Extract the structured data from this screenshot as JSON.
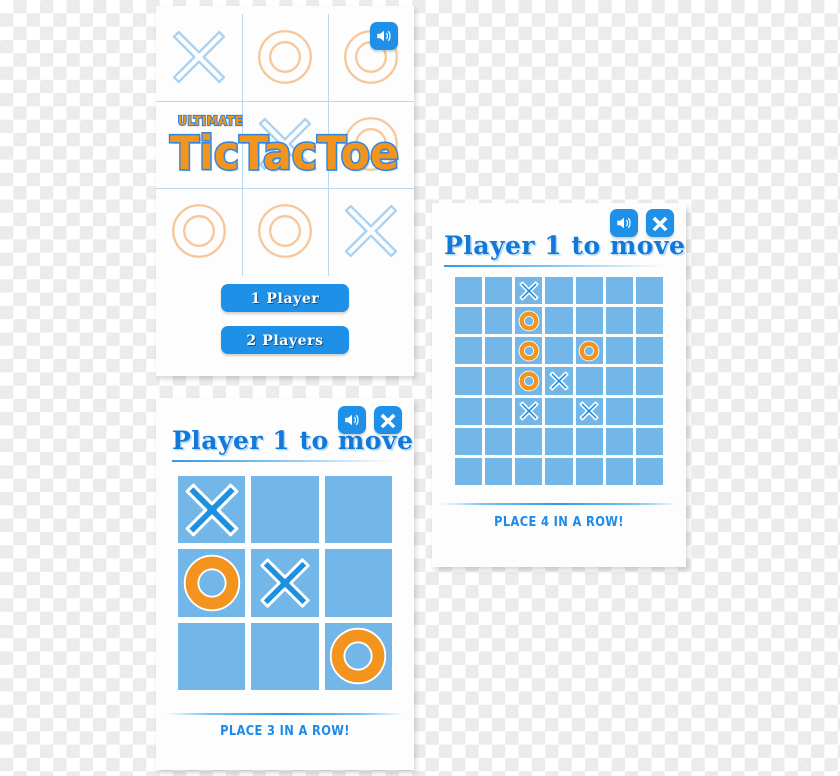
{
  "colors": {
    "brand_blue": "#1E90E8",
    "title_blue": "#1478D8",
    "cell_blue": "#72B7E8",
    "x_blue": "#1E90E0",
    "o_orange": "#F2941E",
    "grid_line": "#b9d9f2",
    "panel_bg": "#fdfdfd"
  },
  "splash": {
    "sound_icon": "speaker-icon",
    "logo_kicker": "ULTIMATE",
    "logo_title": "TicTacToe",
    "background_marks": [
      [
        "X",
        "O",
        "O"
      ],
      [
        "",
        "X",
        "O"
      ],
      [
        "O",
        "O",
        "X"
      ]
    ],
    "buttons": [
      {
        "label": "1 Player"
      },
      {
        "label": "2 Players"
      }
    ]
  },
  "game3": {
    "sound_icon": "speaker-icon",
    "close_icon": "close-x-icon",
    "title": "Player 1 to move",
    "footer": "PLACE 3 IN A ROW!",
    "board": {
      "rows": 3,
      "cols": 3,
      "cells": [
        [
          "X",
          "",
          ""
        ],
        [
          "O",
          "X",
          ""
        ],
        [
          "",
          "",
          "O"
        ]
      ]
    }
  },
  "game7": {
    "sound_icon": "speaker-icon",
    "close_icon": "close-x-icon",
    "title": "Player 1 to move",
    "footer": "PLACE 4 IN A ROW!",
    "board": {
      "rows": 7,
      "cols": 7,
      "cells": [
        [
          "",
          "",
          "X",
          "",
          "",
          "",
          ""
        ],
        [
          "",
          "",
          "O",
          "",
          "",
          "",
          ""
        ],
        [
          "",
          "",
          "O",
          "",
          "O",
          "",
          ""
        ],
        [
          "",
          "",
          "O",
          "X",
          "",
          "",
          ""
        ],
        [
          "",
          "",
          "X",
          "",
          "X",
          "",
          ""
        ],
        [
          "",
          "",
          "",
          "",
          "",
          "",
          ""
        ],
        [
          "",
          "",
          "",
          "",
          "",
          "",
          ""
        ]
      ]
    }
  }
}
